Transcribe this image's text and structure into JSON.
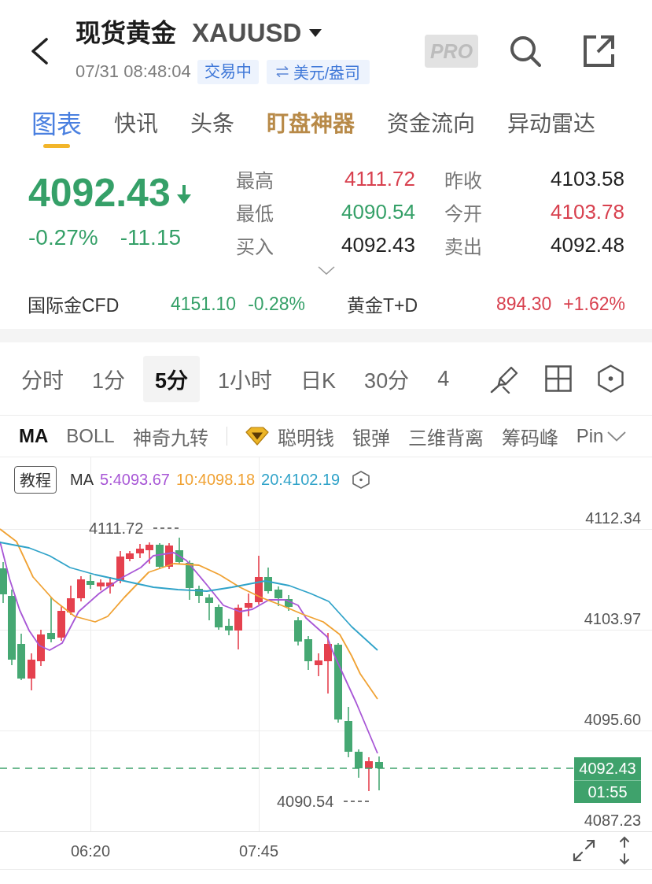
{
  "header": {
    "title": "现货黄金",
    "symbol": "XAUUSD",
    "timestamp": "07/31 08:48:04",
    "status": "交易中",
    "unit": "美元/盎司",
    "pro_badge": "PRO"
  },
  "tabs": [
    {
      "label": "图表",
      "selected": true,
      "kind": "normal"
    },
    {
      "label": "快讯",
      "selected": false,
      "kind": "normal"
    },
    {
      "label": "头条",
      "selected": false,
      "kind": "normal"
    },
    {
      "label": "盯盘神器",
      "selected": false,
      "kind": "featured"
    },
    {
      "label": "资金流向",
      "selected": false,
      "kind": "normal"
    },
    {
      "label": "异动雷达",
      "selected": false,
      "kind": "normal"
    }
  ],
  "quote": {
    "price": "4092.43",
    "falling": true,
    "change_percent": "-0.27%",
    "change": "-11.15",
    "stats": [
      {
        "label": "最高",
        "value": "4111.72",
        "color": "#d8414f"
      },
      {
        "label": "昨收",
        "value": "4103.58",
        "color": "#222222"
      },
      {
        "label": "最低",
        "value": "4090.54",
        "color": "#35a068"
      },
      {
        "label": "今开",
        "value": "4103.78",
        "color": "#d8414f"
      },
      {
        "label": "买入",
        "value": "4092.43",
        "color": "#222222"
      },
      {
        "label": "卖出",
        "value": "4092.48",
        "color": "#222222"
      }
    ]
  },
  "related_markets": [
    {
      "name": "国际金CFD",
      "price": "4151.10",
      "change": "-0.28%",
      "color": "#35a068"
    },
    {
      "name": "黄金T+D",
      "price": "894.30",
      "change": "+1.62%",
      "color": "#d8414f"
    }
  ],
  "intervals": [
    {
      "label": "分时",
      "selected": false
    },
    {
      "label": "1分",
      "selected": false
    },
    {
      "label": "5分",
      "selected": true
    },
    {
      "label": "1小时",
      "selected": false
    },
    {
      "label": "日K",
      "selected": false
    },
    {
      "label": "30分",
      "selected": false
    },
    {
      "label": "4",
      "selected": false
    }
  ],
  "indicators": {
    "main": [
      {
        "label": "MA",
        "selected": true
      },
      {
        "label": "BOLL",
        "selected": false
      },
      {
        "label": "神奇九转",
        "selected": false
      }
    ],
    "featured": [
      {
        "label": "聪明钱",
        "selected": false,
        "kind": "premium"
      },
      {
        "label": "银弹",
        "selected": false,
        "kind": "plain"
      },
      {
        "label": "三维背离",
        "selected": false,
        "kind": "plain"
      },
      {
        "label": "筹码峰",
        "selected": false,
        "kind": "plain"
      },
      {
        "label": "Pin",
        "selected": false,
        "kind": "plain"
      }
    ]
  },
  "chart": {
    "tutorial_button": "教程",
    "ma_title": "MA",
    "ma_legend": [
      {
        "label": "5:4093.67",
        "color": "#a857d6"
      },
      {
        "label": "10:4098.18",
        "color": "#f0a234"
      },
      {
        "label": "20:4102.19",
        "color": "#30a3c9"
      }
    ],
    "y_axis_labels": [
      "4112.34",
      "4103.97",
      "4095.60",
      "4087.23"
    ],
    "x_axis_labels": [
      "06:20",
      "07:45"
    ],
    "high_marker": "4111.72",
    "low_marker": "4090.54",
    "last_price": "4092.43",
    "countdown": "01:55"
  }
}
